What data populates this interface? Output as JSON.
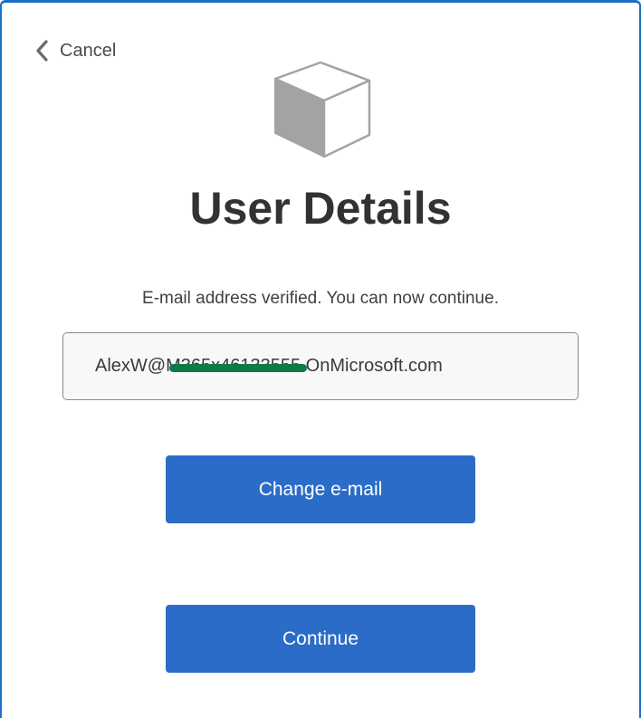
{
  "header": {
    "cancel_label": "Cancel"
  },
  "icons": {
    "back": "chevron-left-icon",
    "logo": "cube-icon"
  },
  "page": {
    "title": "User Details",
    "message": "E-mail address verified. You can now continue."
  },
  "email": {
    "value": "AlexW@M365x46133555.OnMicrosoft.com",
    "redacted": true
  },
  "buttons": {
    "change_email_label": "Change e-mail",
    "continue_label": "Continue"
  },
  "colors": {
    "accent": "#2b6cc8",
    "frame_border": "#1a73c8",
    "redaction": "#0d7a48"
  }
}
